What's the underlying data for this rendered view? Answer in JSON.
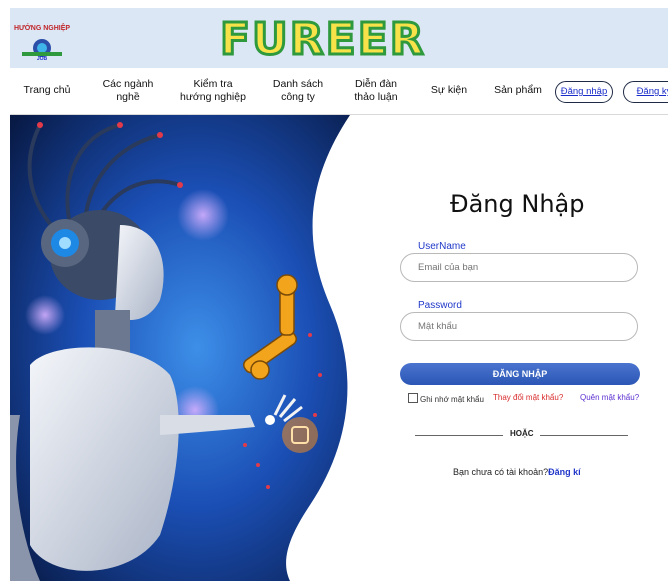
{
  "header": {
    "logo_text_top": "HƯỚNG NGHIỆP",
    "logo_text_bottom": "JOB",
    "brand": "FUREER"
  },
  "nav": {
    "items": [
      {
        "label": "Trang chủ"
      },
      {
        "label": "Các ngành nghề"
      },
      {
        "label": "Kiểm tra hướng nghiệp"
      },
      {
        "label": "Danh sách công ty"
      },
      {
        "label": "Diễn đàn thảo luận"
      },
      {
        "label": "Sự kiện"
      },
      {
        "label": "Sản phẩm"
      }
    ],
    "login_label": "Đăng nhập",
    "register_label": "Đăng ký"
  },
  "form": {
    "title": "Đăng Nhập",
    "username_label": "UserName",
    "username_placeholder": "Email của bạn",
    "password_label": "Password",
    "password_placeholder": "Mật khẩu",
    "submit_label": "ĐĂNG NHẬP",
    "remember_label": "Ghi nhớ mật khẩu",
    "change_password": "Thay đổi mật khẩu?",
    "forgot_password": "Quên mật khẩu?",
    "or_text": "HOẶC",
    "no_account_text": "Bạn chưa có tài khoản?",
    "signup_link": "Đăng kí"
  },
  "colors": {
    "brand_fill": "#f7e24a",
    "brand_stroke": "#2f9a3d",
    "accent": "#2b56b5",
    "link": "#1f38c9",
    "warning_link": "#d92b2b"
  }
}
